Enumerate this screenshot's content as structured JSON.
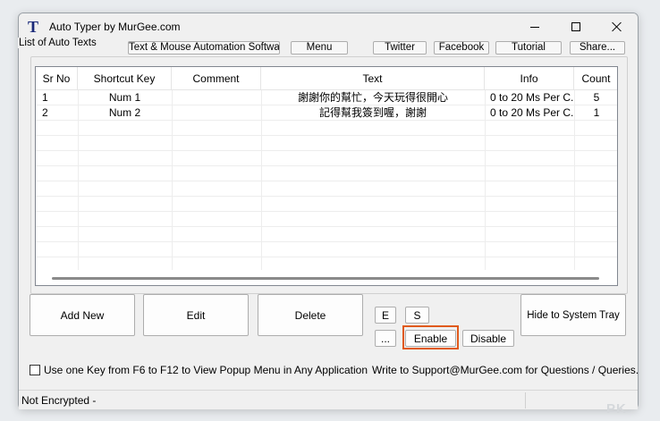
{
  "window": {
    "title": "Auto Typer by MurGee.com",
    "icon_glyph": "T"
  },
  "top_buttons": [
    "Text & Mouse Automation Software",
    "Menu",
    "Twitter",
    "Facebook",
    "Tutorial",
    "Share..."
  ],
  "group": {
    "label": "List of Auto Texts"
  },
  "table": {
    "columns": [
      "Sr No",
      "Shortcut Key",
      "Comment",
      "Text",
      "Info",
      "Count"
    ],
    "rows": [
      {
        "sr": "1",
        "key": "Num 1",
        "comment": "",
        "text": "謝謝你的幫忙，今天玩得很開心",
        "info": "0 to 20 Ms Per C...",
        "count": "5"
      },
      {
        "sr": "2",
        "key": "Num 2",
        "comment": "",
        "text": "記得幫我簽到喔，謝謝",
        "info": "0 to 20 Ms Per C...",
        "count": "1"
      }
    ]
  },
  "buttons": {
    "add_new": "Add New",
    "edit": "Edit",
    "delete": "Delete",
    "e": "E",
    "s": "S",
    "more": "...",
    "enable": "Enable",
    "disable": "Disable",
    "hide_tray": "Hide to System Tray"
  },
  "options": {
    "checkbox_label": "Use one Key from F6 to F12 to View Popup Menu in Any Application",
    "checked": false
  },
  "support_text": "Write to Support@MurGee.com for Questions / Queries.",
  "status": {
    "text": "Not Encrypted -"
  },
  "watermark": "PK",
  "colors": {
    "highlight": "#e05a1c",
    "icon": "#1b2a7a"
  }
}
